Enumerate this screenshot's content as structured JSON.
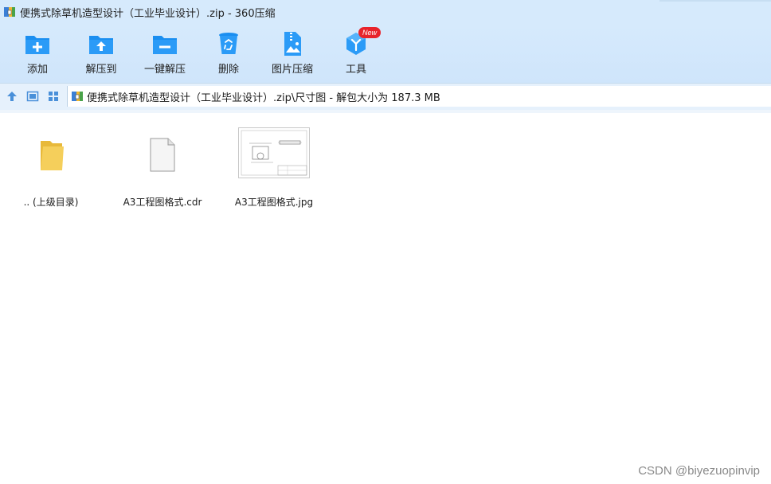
{
  "window": {
    "title": "便携式除草机造型设计（工业毕业设计）.zip - 360压缩",
    "app_icon": "archive-app-icon"
  },
  "toolbar": {
    "items": [
      {
        "label": "添加",
        "icon": "folder-add-icon"
      },
      {
        "label": "解压到",
        "icon": "folder-extract-icon"
      },
      {
        "label": "一键解压",
        "icon": "folder-quick-extract-icon"
      },
      {
        "label": "删除",
        "icon": "recycle-bin-icon"
      },
      {
        "label": "图片压缩",
        "icon": "image-compress-icon"
      },
      {
        "label": "工具",
        "icon": "tools-cube-icon",
        "badge": "New"
      }
    ]
  },
  "addressbar": {
    "path": "便携式除草机造型设计（工业毕业设计）.zip\\尺寸图 - 解包大小为 187.3 MB"
  },
  "files": [
    {
      "name": ".. (上级目录)",
      "type": "parent-folder"
    },
    {
      "name": "A3工程图格式.cdr",
      "type": "document"
    },
    {
      "name": "A3工程图格式.jpg",
      "type": "image"
    }
  ],
  "watermark": "CSDN @biyezuopinvip",
  "colors": {
    "toolbar_bg": "#d6eafc",
    "icon_blue": "#1a8ef0",
    "badge_red": "#e8232b",
    "folder_yellow": "#f5cf5b"
  }
}
